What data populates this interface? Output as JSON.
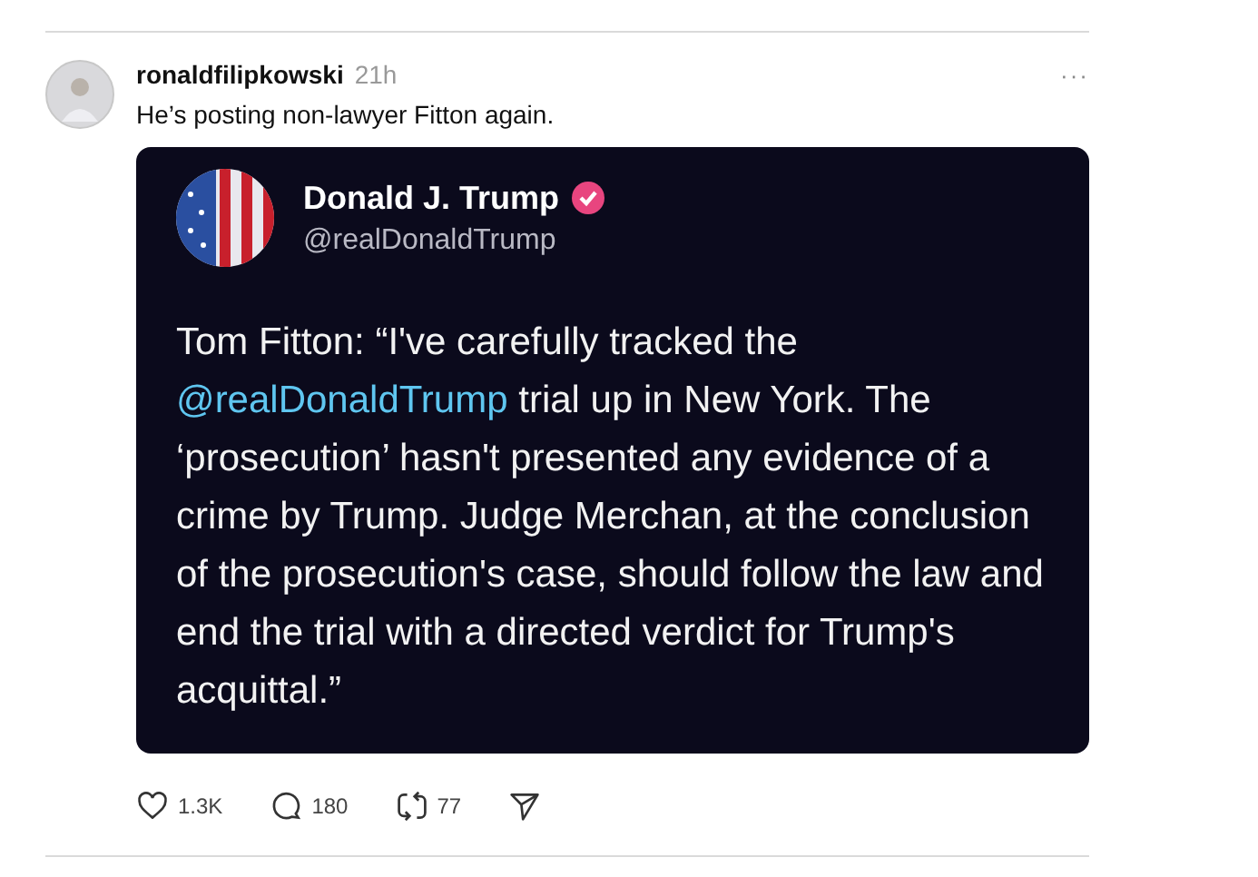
{
  "post": {
    "username": "ronaldfilipkowski",
    "time": "21h",
    "more": "···",
    "text": "He’s posting non-lawyer Fitton again.",
    "embed": {
      "name": "Donald J. Trump",
      "verified": true,
      "handle": "@realDonaldTrump",
      "body": [
        {
          "kind": "text",
          "text": "Tom Fitton: “I've carefully tracked the "
        },
        {
          "kind": "mention",
          "text": "@realDonaldTrump"
        },
        {
          "kind": "text",
          "text": " trial up in New York. The ‘prosecution’ hasn't presented any evidence of a crime by Trump. Judge Merchan, at the conclusion of the prosecution's case, should follow the law and end the trial with a directed verdict for Trump's acquittal.”"
        }
      ]
    },
    "actions": [
      {
        "kind": "like",
        "count": "1.3K"
      },
      {
        "kind": "reply",
        "count": "180"
      },
      {
        "kind": "repost",
        "count": "77"
      },
      {
        "kind": "share"
      }
    ]
  }
}
